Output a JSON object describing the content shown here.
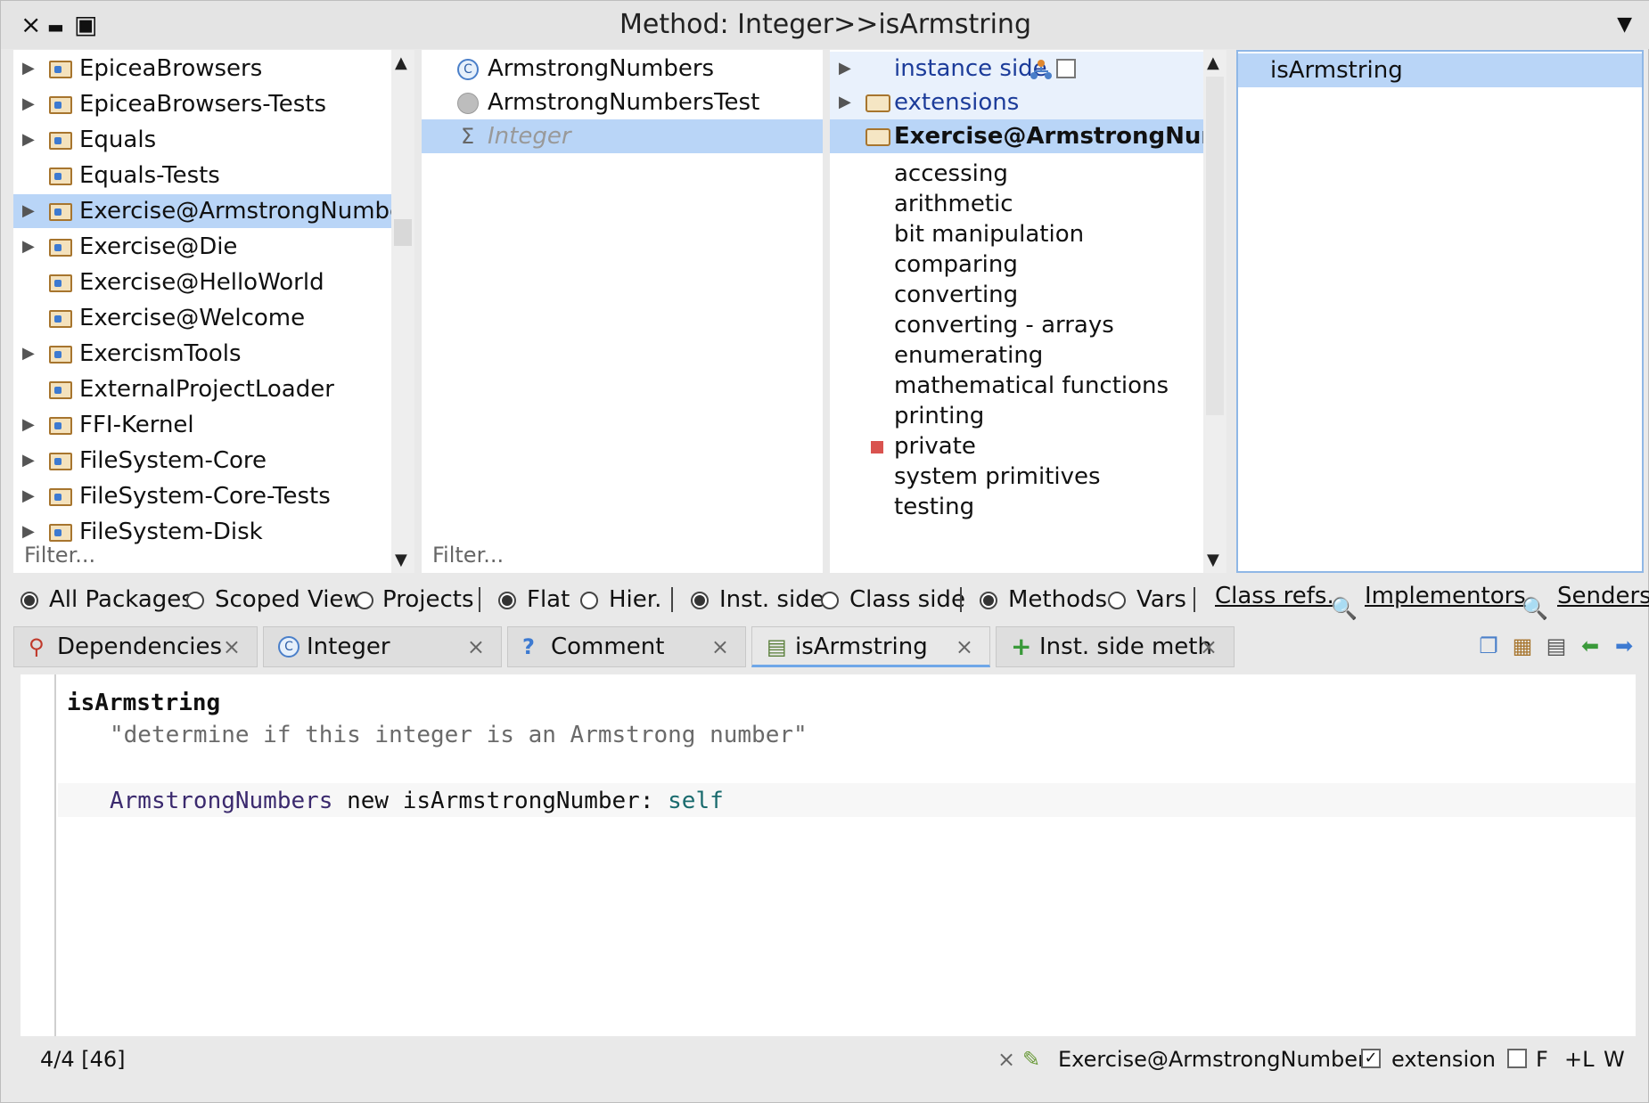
{
  "window": {
    "title": "Method: Integer>>isArmstring",
    "close_glyph": "×",
    "minimize_glyph": "▬",
    "maximize_glyph": "▣",
    "menu_glyph": "▼"
  },
  "packages": {
    "items": [
      {
        "label": "EpiceaBrowsers",
        "expandable": true
      },
      {
        "label": "EpiceaBrowsers-Tests",
        "expandable": true
      },
      {
        "label": "Equals",
        "expandable": true
      },
      {
        "label": "Equals-Tests",
        "expandable": false
      },
      {
        "label": "Exercise@ArmstrongNumbers",
        "expandable": true,
        "selected": true
      },
      {
        "label": "Exercise@Die",
        "expandable": true
      },
      {
        "label": "Exercise@HelloWorld",
        "expandable": false
      },
      {
        "label": "Exercise@Welcome",
        "expandable": false
      },
      {
        "label": "ExercismTools",
        "expandable": true
      },
      {
        "label": "ExternalProjectLoader",
        "expandable": false
      },
      {
        "label": "FFI-Kernel",
        "expandable": true
      },
      {
        "label": "FileSystem-Core",
        "expandable": true
      },
      {
        "label": "FileSystem-Core-Tests",
        "expandable": true
      },
      {
        "label": "FileSystem-Disk",
        "expandable": true
      }
    ],
    "filter_placeholder": "Filter..."
  },
  "classes": {
    "items": [
      {
        "label": "ArmstrongNumbers",
        "icon": "class-icon"
      },
      {
        "label": "ArmstrongNumbersTest",
        "icon": "test-class-icon"
      },
      {
        "label": "Integer",
        "icon": "sigma-icon",
        "selected": true,
        "extension": true
      }
    ],
    "filter_placeholder": "Filter..."
  },
  "protocols": {
    "instance_side": "instance side",
    "extensions": "extensions",
    "selected": "Exercise@ArmstrongNumbers",
    "items": [
      "accessing",
      "arithmetic",
      "bit manipulation",
      "comparing",
      "converting",
      "converting - arrays",
      "enumerating",
      "mathematical functions",
      "printing",
      "private",
      "system primitives",
      "testing"
    ]
  },
  "methods": {
    "items": [
      "isArmstring"
    ]
  },
  "toolbar": {
    "all_packages": "All Packages",
    "scoped_view": "Scoped View",
    "projects": "Projects",
    "flat": "Flat",
    "hier": "Hier.",
    "inst_side": "Inst. side",
    "class_side": "Class side",
    "methods": "Methods",
    "vars": "Vars",
    "class_refs": "Class refs.",
    "implementors": "Implementors",
    "senders": "Senders"
  },
  "tabs": [
    {
      "label": "Dependencies",
      "icon": "dependencies-icon"
    },
    {
      "label": "Integer",
      "icon": "class-icon"
    },
    {
      "label": "Comment",
      "icon": "question-icon"
    },
    {
      "label": "isArmstring",
      "icon": "method-icon",
      "active": true
    },
    {
      "label": "Inst. side meth",
      "icon": "plus-icon"
    }
  ],
  "editor": {
    "selector": "isArmstring",
    "comment": "\"determine if this integer is an Armstrong number\"",
    "code_class": "ArmstrongNumbers",
    "code_middle": " new isArmstrongNumber: ",
    "code_self": "self"
  },
  "status": {
    "position": "4/4 [46]",
    "package": "Exercise@ArmstrongNumbers",
    "extension_label": "extension",
    "extension_checked": true,
    "f_label": "F",
    "l_label": "+L",
    "w_label": "W"
  },
  "colors": {
    "selection": "#b9d5f7",
    "accent": "#6fa7e8",
    "private_marker": "#d9534f"
  }
}
